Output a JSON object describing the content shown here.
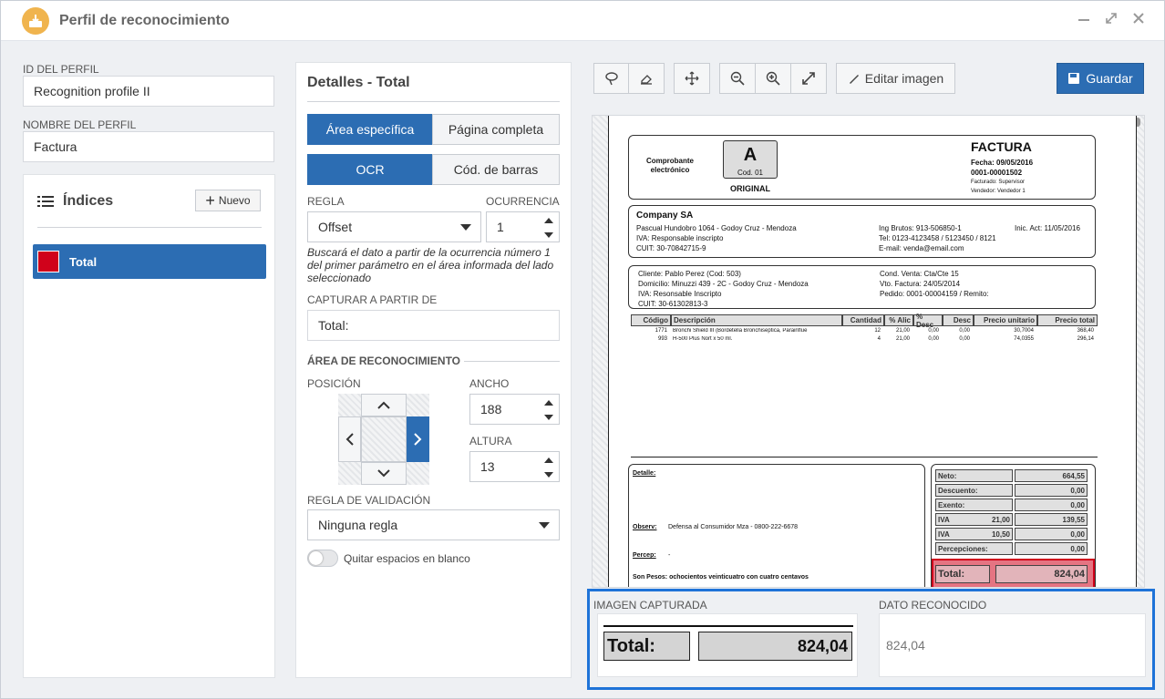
{
  "window": {
    "title": "Perfil de reconocimiento",
    "minimize_icon": "minimize-icon",
    "maximize_icon": "expand-icon",
    "close_icon": "close-icon"
  },
  "left": {
    "profile_id_label": "ID DEL PERFIL",
    "profile_id_value": "Recognition profile II",
    "profile_name_label": "NOMBRE DEL PERFIL",
    "profile_name_value": "Factura",
    "indices_title": "Índices",
    "new_button": "Nuevo",
    "items": [
      {
        "label": "Total",
        "color": "#d0021b"
      }
    ]
  },
  "details": {
    "title": "Detalles - Total",
    "area_tabs": [
      "Área específica",
      "Página completa"
    ],
    "mode_tabs": [
      "OCR",
      "Cód. de barras"
    ],
    "rule_label": "REGLA",
    "rule_value": "Offset",
    "occurrence_label": "OCURRENCIA",
    "occurrence_value": "1",
    "help_text": "Buscará el dato a partir de la ocurrencia número 1 del primer parámetro en el área informada del lado seleccionado",
    "capture_from_label": "CAPTURAR A PARTIR DE",
    "capture_from_value": "Total:",
    "recognition_area_label": "ÁREA DE RECONOCIMIENTO",
    "position_label": "POSICIÓN",
    "width_label": "ANCHO",
    "width_value": "188",
    "height_label": "ALTURA",
    "height_value": "13",
    "validation_rule_label": "REGLA DE VALIDACIÓN",
    "validation_rule_value": "Ninguna regla",
    "remove_spaces_label": "Quitar espacios en blanco",
    "remove_spaces_on": false
  },
  "toolbar": {
    "edit_image": "Editar imagen",
    "save": "Guardar"
  },
  "invoice": {
    "header_left": "Comprobante electrónico",
    "letter": "A",
    "cod": "Cod. 01",
    "original": "ORIGINAL",
    "type": "FACTURA",
    "fecha": "Fecha: 09/05/2016",
    "number": "0001-00001502",
    "facturado": "Facturado: Supervisor",
    "vendedor": "Vendedor: Vendedor 1",
    "company": "Company SA",
    "addr": "Pascual Hundobro 1064 - Godoy Cruz - Mendoza",
    "iva_company": "IVA: Responsable inscripto",
    "cuit_company": "CUIT: 30-70842715-9",
    "ing_brutos": "Ing Brutos: 913-506850-1",
    "inic_act": "Inic. Act: 11/05/2016",
    "tel": "Tel: 0123-4123458 / 5123450 / 8121",
    "email": "E-mail: venda@email.com",
    "cliente": "Cliente: Pablo Perez (Cod: 503)",
    "domicilio": "Domicilio: Minuzzi 439 - 2C - Godoy Cruz - Mendoza",
    "iva_client": "IVA: Resonsable Inscripto",
    "cuit_client": "CUIT: 30-61302813-3",
    "cond_venta": "Cond. Venta: Cta/Cte 15",
    "vto": "Vto. Factura: 24/05/2014",
    "pedido": "Pedido: 0001-00004159 / Remito:",
    "columns": [
      "Código",
      "Descripción",
      "Cantidad",
      "% Alic",
      "% Desc",
      "Desc",
      "Precio unitario",
      "Precio total"
    ],
    "rows": [
      [
        "1771",
        "Bronchi Shield III (Bordetella Bronchiseptica, Parainflue",
        "12",
        "21,00",
        "0,00",
        "0,00",
        "30,7004",
        "368,40"
      ],
      [
        "993",
        "H-500 Plus Nort x 50 ml.",
        "4",
        "21,00",
        "0,00",
        "0,00",
        "74,0355",
        "296,14"
      ]
    ],
    "detalle": "Detalle:",
    "observ": "Observ:",
    "observ_text": "Defensa al Consumidor Mza - 0800-222-6678",
    "percep": "Percep:",
    "percep_text": "-",
    "son_pesos": "Son Pesos: ochocientos veinticuatro con cuatro centavos",
    "totals": [
      {
        "label": "Neto:",
        "value": "664,55"
      },
      {
        "label": "Descuento:",
        "value": "0,00"
      },
      {
        "label": "Exento:",
        "value": "0,00"
      },
      {
        "label": "IVA",
        "rate": "21,00",
        "value": "139,55"
      },
      {
        "label": "IVA",
        "rate": "10,50",
        "value": "0,00"
      },
      {
        "label": "Percepciones:",
        "value": "0,00"
      }
    ],
    "total_label": "Total:",
    "total_value": "824,04"
  },
  "result": {
    "captured_label": "IMAGEN CAPTURADA",
    "captured_total_label": "Total:",
    "captured_total_value": "824,04",
    "recognized_label": "DATO RECONOCIDO",
    "recognized_value": "824,04"
  }
}
